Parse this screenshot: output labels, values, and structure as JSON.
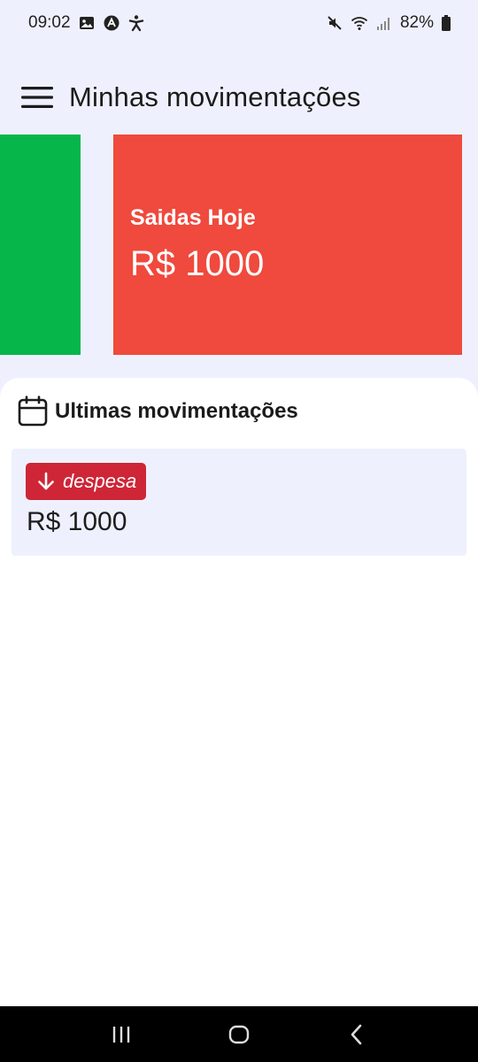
{
  "status_bar": {
    "time": "09:02",
    "battery": "82%",
    "icons": [
      "image-icon",
      "app-badge-icon",
      "accessibility-icon",
      "mute-icon",
      "wifi-icon",
      "signal-icon",
      "battery-icon"
    ]
  },
  "header": {
    "menu_icon": "hamburger-menu-icon",
    "title": "Minhas movimentações"
  },
  "cards": [
    {
      "color": "#06b64a"
    },
    {
      "label": "Saidas Hoje",
      "value": "R$ 1000",
      "color": "#f0493d"
    }
  ],
  "recent": {
    "icon": "calendar-icon",
    "title": "Ultimas movimentações",
    "items": [
      {
        "type_label": "despesa",
        "type_icon": "arrow-down-icon",
        "badge_color": "#ce2637",
        "amount": "R$ 1000"
      }
    ]
  },
  "nav_bar": {
    "buttons": [
      "recent-apps-icon",
      "home-icon",
      "back-icon"
    ]
  }
}
